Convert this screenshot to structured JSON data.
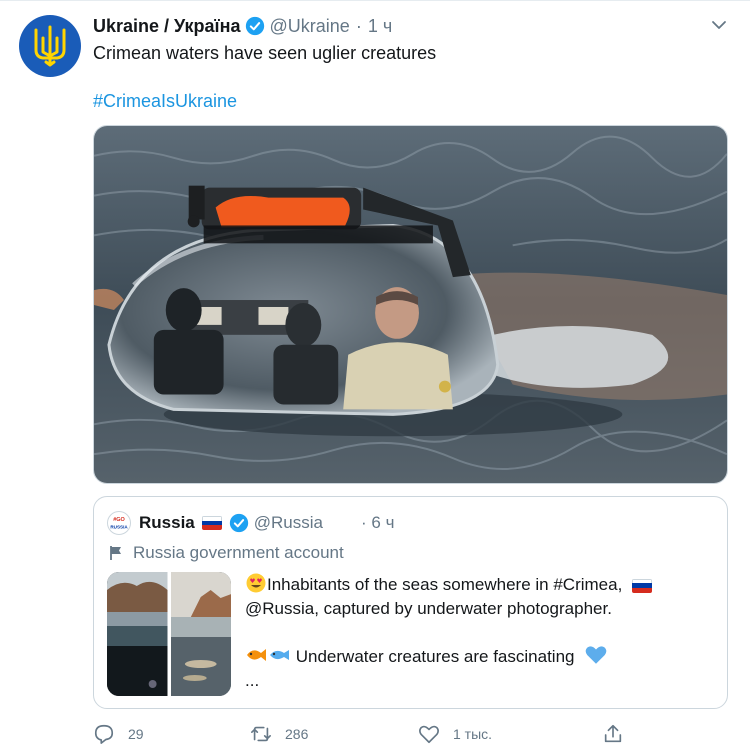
{
  "tweet": {
    "author_name": "Ukraine / Україна",
    "handle": "@Ukraine",
    "separator": "·",
    "time": "1 ч",
    "text": "Crimean waters have seen uglier creatures",
    "hashtag": "#CrimeaIsUkraine",
    "avatar_icon": "ukraine-trident-icon",
    "menu_icon": "chevron-down-icon"
  },
  "quoted_tweet": {
    "author_name": "Russia",
    "handle": "@Russia",
    "separator": "·",
    "time": "6 ч",
    "label": "Russia government account",
    "line1": "Inhabitants of the seas somewhere in #Crimea,",
    "line2": "@Russia, captured by underwater photographer.",
    "line3": "Underwater creatures are fascinating",
    "ellipsis": "...",
    "avatar_text": "#GO RUSSIA"
  },
  "actions": {
    "replies": "29",
    "retweets": "286",
    "likes": "1 тыс.",
    "share_icon": "share-icon"
  },
  "colors": {
    "link": "#1b95e0",
    "verified": "#1da1f2",
    "muted": "#657786",
    "avatar_bg": "#1a5cb8",
    "trident": "#ffd500"
  }
}
